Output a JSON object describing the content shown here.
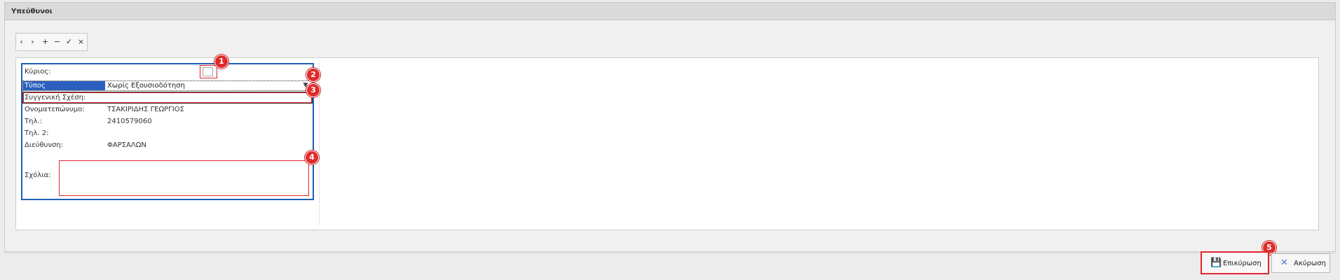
{
  "panel": {
    "title": "Υπεύθυνοι"
  },
  "toolbar": {
    "buttons": [
      {
        "name": "prev",
        "glyph": "‹"
      },
      {
        "name": "next",
        "glyph": "›"
      },
      {
        "name": "add",
        "glyph": "+"
      },
      {
        "name": "remove",
        "glyph": "−"
      },
      {
        "name": "save",
        "glyph": "✓"
      },
      {
        "name": "cancel",
        "glyph": "×"
      }
    ]
  },
  "form": {
    "main_label": "Κύριος:",
    "main_checked": false,
    "authorization_type_label": "Τύπος Εξουσιοδότησης:",
    "authorization_type_value": "Χωρίς Εξουσιοδότηση",
    "relation_label": "Συγγενική Σχέση:",
    "relation_value": "",
    "fullname_label": "Ονοματεπώνυμο:",
    "fullname_value": "ΤΣΑΚΙΡΙΔΗΣ ΓΕΩΡΓΙΟΣ",
    "phone_label": "Τηλ.:",
    "phone_value": "2410579060",
    "phone2_label": "Τηλ. 2:",
    "phone2_value": "",
    "address_label": "Διεύθυνση:",
    "address_value": "ΦΑΡΣΑΛΩΝ",
    "comments_label": "Σχόλια:",
    "comments_value": ""
  },
  "badges": [
    "1",
    "2",
    "3",
    "4",
    "5"
  ],
  "footer": {
    "confirm_label": "Επικύρωση",
    "cancel_label": "Ακύρωση"
  },
  "colors": {
    "accent_blue": "#1f5fb8",
    "highlight_red": "#e2262f",
    "badge_red": "#e02b2b"
  },
  "icons": {
    "confirm": "floppy-disk-icon",
    "cancel": "cross-icon",
    "dropdown": "chevron-down-icon"
  }
}
